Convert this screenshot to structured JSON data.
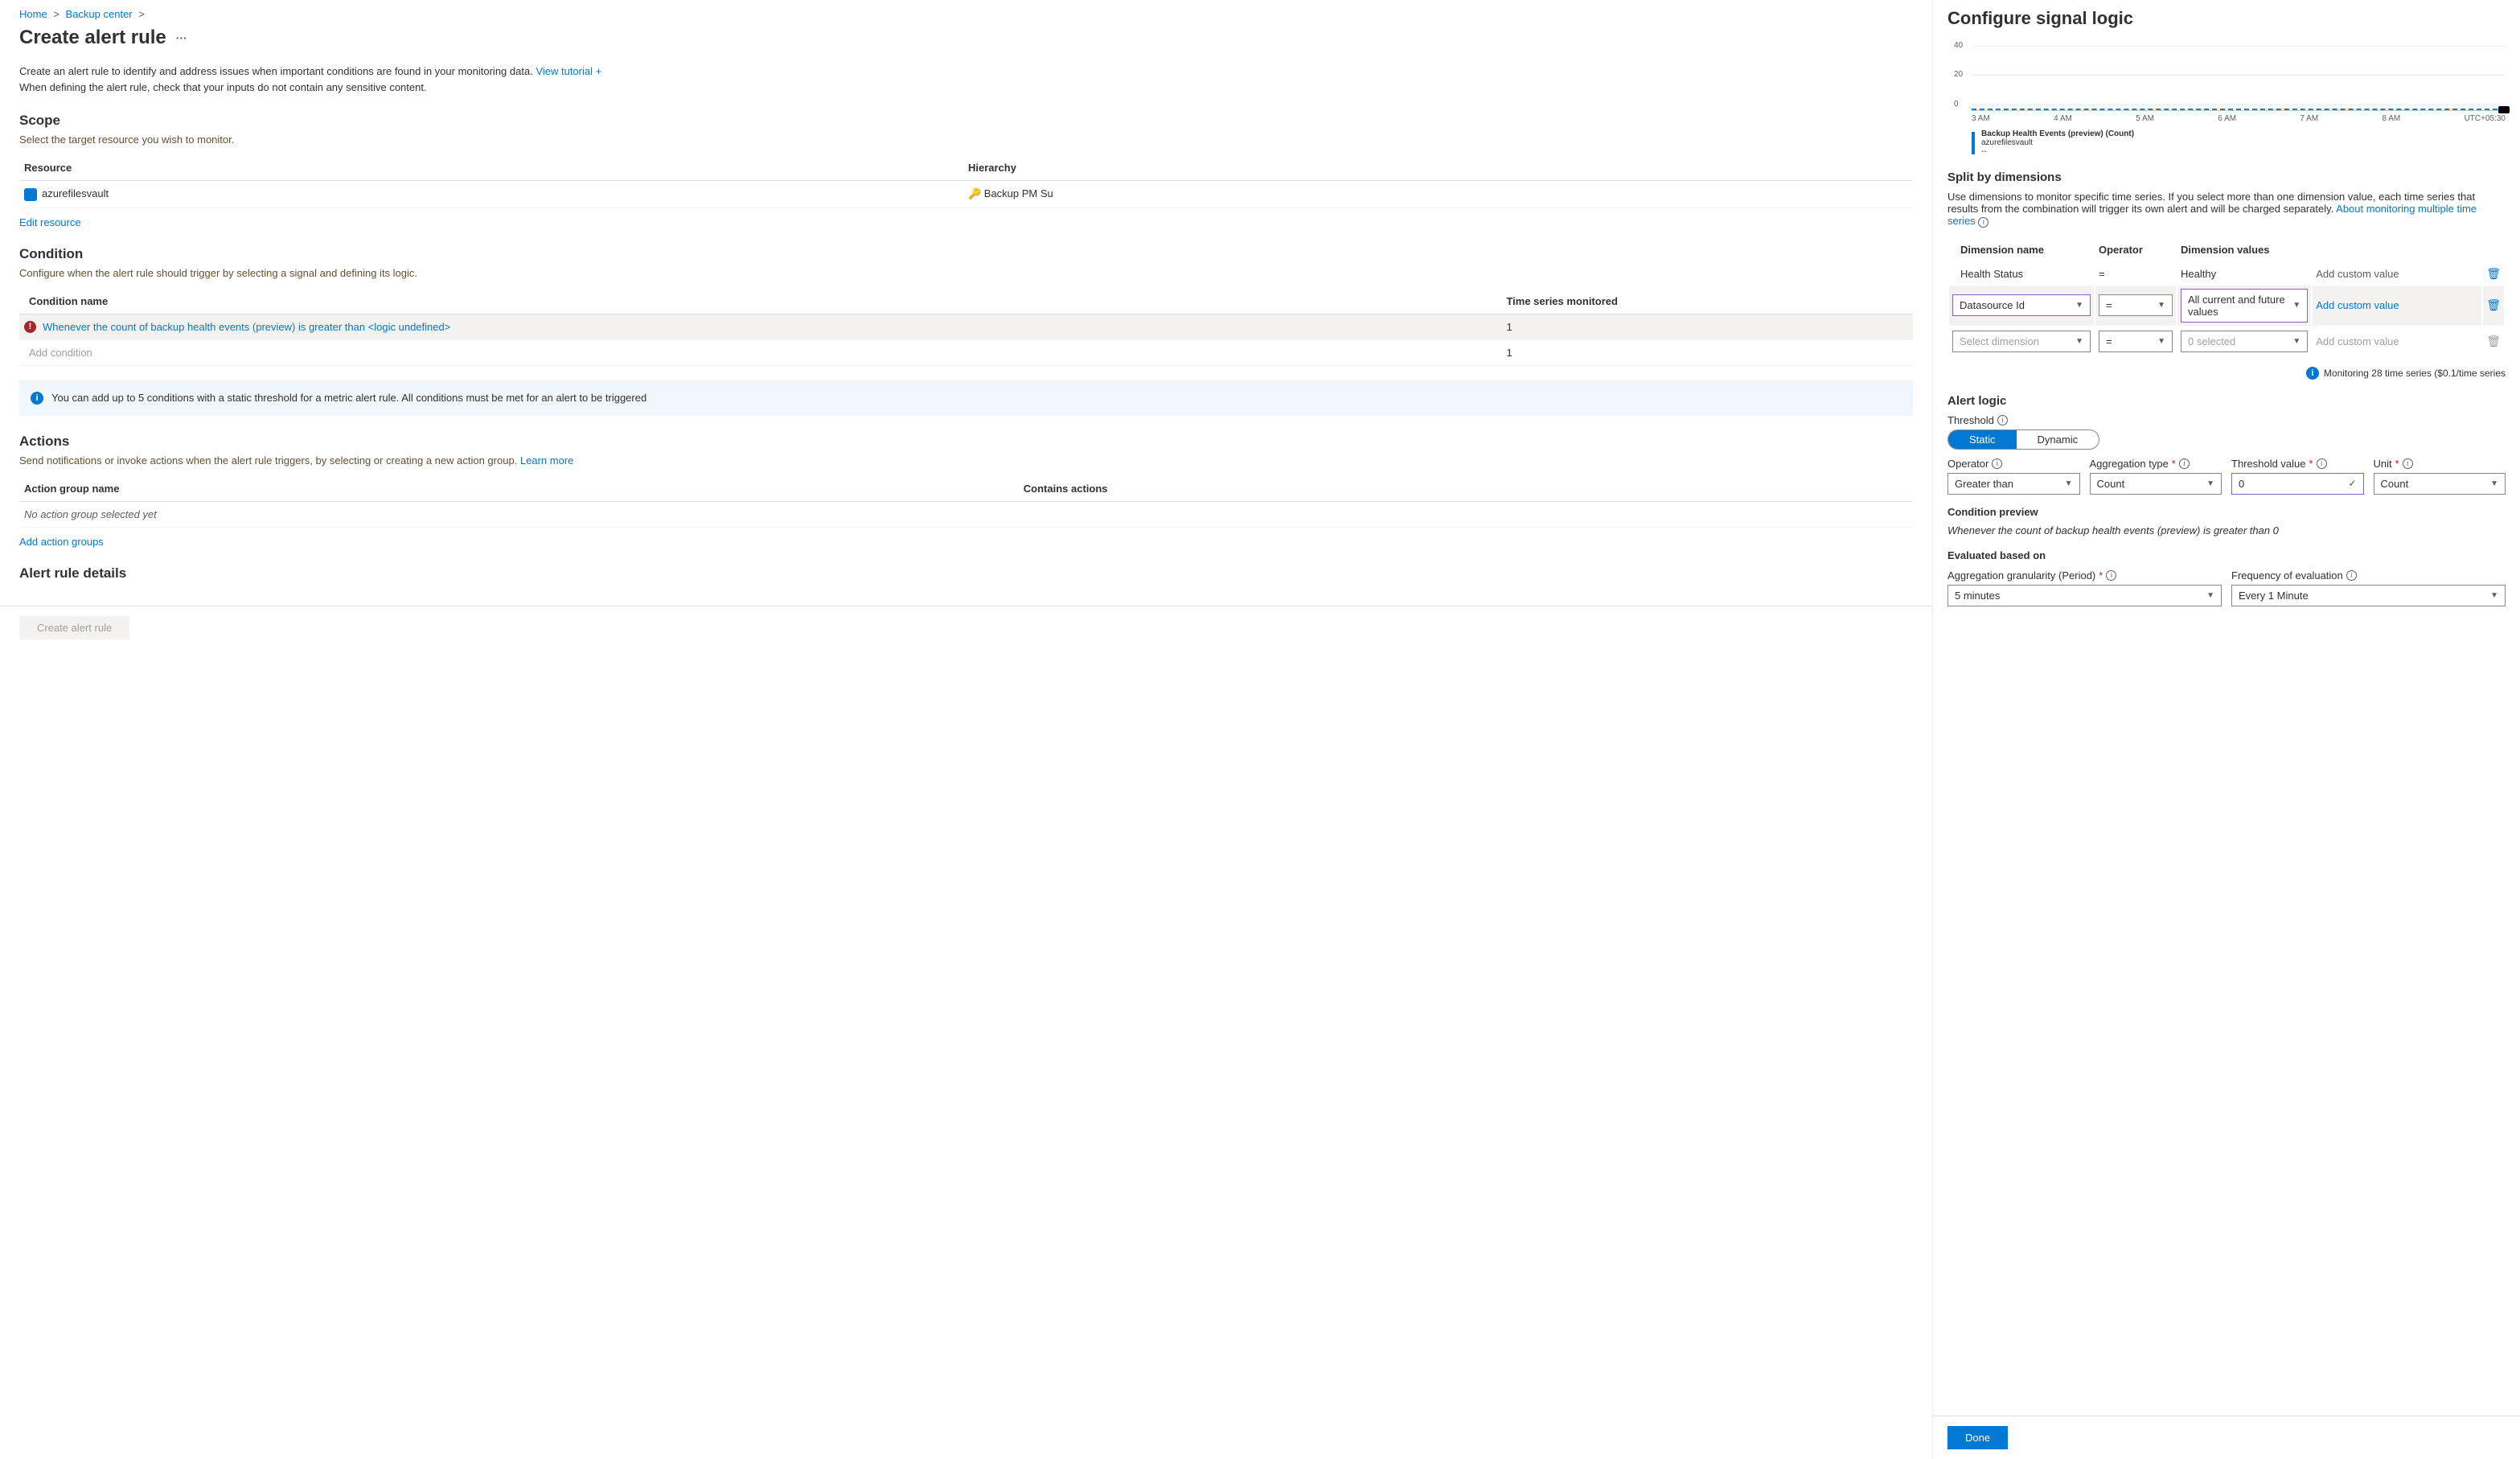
{
  "breadcrumb": {
    "home": "Home",
    "backup_center": "Backup center"
  },
  "page_title": "Create alert rule",
  "intro_text": "Create an alert rule to identify and address issues when important conditions are found in your monitoring data. ",
  "view_tutorial": "View tutorial +",
  "intro_line2": "When defining the alert rule, check that your inputs do not contain any sensitive content.",
  "scope": {
    "heading": "Scope",
    "sub": "Select the target resource you wish to monitor.",
    "col_resource": "Resource",
    "col_hierarchy": "Hierarchy",
    "resource_name": "azurefilesvault",
    "hierarchy_name": "Backup PM Su",
    "edit_link": "Edit resource"
  },
  "condition": {
    "heading": "Condition",
    "sub": "Configure when the alert rule should trigger by selecting a signal and defining its logic.",
    "col_name": "Condition name",
    "col_ts": "Time series monitored",
    "row1_name": "Whenever the count of backup health events (preview) is greater than <logic undefined>",
    "row1_ts": "1",
    "add_condition": "Add condition",
    "add_ts": "1",
    "info": "You can add up to 5 conditions with a static threshold for a metric alert rule. All conditions must be met for an alert to be triggered"
  },
  "actions": {
    "heading": "Actions",
    "sub_prefix": "Send notifications or invoke actions when the alert rule triggers, by selecting or creating a new action group. ",
    "learn_more": "Learn more",
    "col_name": "Action group name",
    "col_contains": "Contains actions",
    "empty": "No action group selected yet",
    "add_link": "Add action groups"
  },
  "details_heading": "Alert rule details",
  "create_btn": "Create alert rule",
  "panel": {
    "title": "Configure signal logic",
    "chart_legend_title": "Backup Health Events (preview) (Count)",
    "chart_legend_sub": "azurefilesvault",
    "chart_legend_val": "--",
    "split_heading": "Split by dimensions",
    "split_desc": "Use dimensions to monitor specific time series. If you select more than one dimension value, each time series that results from the combination will trigger its own alert and will be charged separately. ",
    "split_link": "About monitoring multiple time series",
    "dim_col_name": "Dimension name",
    "dim_col_op": "Operator",
    "dim_col_val": "Dimension values",
    "dim_row1_name": "Health Status",
    "dim_row1_op": "=",
    "dim_row1_val": "Healthy",
    "dim_row1_custom": "Add custom value",
    "dim_row2_name": "Datasource Id",
    "dim_row2_op": "=",
    "dim_row2_val": "All current and future values",
    "dim_row2_custom": "Add custom value",
    "dim_row3_name": "Select dimension",
    "dim_row3_op": "=",
    "dim_row3_val": "0 selected",
    "dim_row3_custom": "Add custom value",
    "monitoring_note": "Monitoring 28 time series ($0.1/time series",
    "alert_logic_heading": "Alert logic",
    "threshold_label": "Threshold",
    "toggle_static": "Static",
    "toggle_dynamic": "Dynamic",
    "operator_label": "Operator",
    "operator_val": "Greater than",
    "aggtype_label": "Aggregation type",
    "aggtype_val": "Count",
    "threshval_label": "Threshold value",
    "threshval_val": "0",
    "unit_label": "Unit",
    "unit_val": "Count",
    "preview_heading": "Condition preview",
    "preview_text": "Whenever the count of backup health events (preview) is greater than 0",
    "eval_heading": "Evaluated based on",
    "agg_gran_label": "Aggregation granularity (Period)",
    "agg_gran_val": "5 minutes",
    "freq_label": "Frequency of evaluation",
    "freq_val": "Every 1 Minute",
    "done_btn": "Done"
  },
  "chart_data": {
    "type": "line",
    "title": "Backup Health Events (preview) (Count)",
    "series": [
      {
        "name": "azurefilesvault",
        "values": [
          0,
          0,
          0,
          0,
          0,
          0,
          0
        ]
      }
    ],
    "x_ticks": [
      "3 AM",
      "4 AM",
      "5 AM",
      "6 AM",
      "7 AM",
      "8 AM",
      "UTC+05:30"
    ],
    "y_ticks": [
      0,
      20,
      40
    ],
    "ylim": [
      0,
      50
    ]
  }
}
